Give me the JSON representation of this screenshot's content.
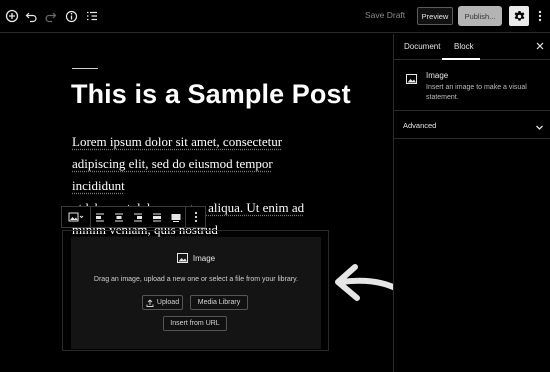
{
  "topbar": {
    "save_draft": "Save Draft",
    "preview": "Preview",
    "publish": "Publish...",
    "icons": [
      "add-block-icon",
      "undo-icon",
      "redo-icon",
      "info-icon",
      "outline-icon",
      "settings-gear-icon",
      "more-vertical-icon"
    ]
  },
  "editor": {
    "title": "This is a Sample Post",
    "paragraph_lines": [
      "Lorem ipsum dolor sit amet, consectetur",
      "adipiscing elit, sed do eiusmod tempor incididunt",
      "ut labore et dolore magna aliqua. Ut enim ad",
      "minim veniam, quis nostrud"
    ],
    "image_block": {
      "label": "Image",
      "instructions": "Drag an image, upload a new one or select a file from your library.",
      "upload": "Upload",
      "media_library": "Media Library",
      "insert_url": "Insert from URL"
    }
  },
  "sidebar": {
    "tabs": [
      "Document",
      "Block"
    ],
    "active_tab": "Block",
    "block_title": "Image",
    "block_description": "Insert an image to make a visual statement.",
    "advanced": "Advanced"
  },
  "colors": {
    "background": "#000000",
    "placeholder_bg": "#141414",
    "publish_bg": "#b4b4b4",
    "arrow": "#e6e6e6"
  }
}
